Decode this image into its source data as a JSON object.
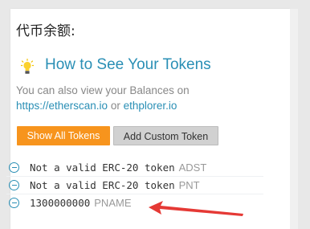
{
  "panel": {
    "title": "代币余额:",
    "how_to_link": "How to See Your Tokens",
    "description_text": "You can also view your Balances on",
    "etherscan_link": "https://etherscan.io",
    "or_text": "or",
    "ethplorer_link": "ethplorer.io"
  },
  "buttons": {
    "show_all": "Show All Tokens",
    "add_custom": "Add Custom Token"
  },
  "tokens": [
    {
      "balance": "Not a valid ERC-20 token",
      "symbol": "ADST"
    },
    {
      "balance": "Not a valid ERC-20 token",
      "symbol": "PNT"
    },
    {
      "balance": "1300000000",
      "symbol": "PNAME"
    }
  ],
  "colors": {
    "accent_orange": "#f7941d",
    "link_blue": "#2a8fb5",
    "annotation_red": "#e53935"
  },
  "icons": {
    "bulb": "lightbulb-icon",
    "remove": "minus-circle-icon",
    "annotation": "red-arrow-annotation"
  }
}
